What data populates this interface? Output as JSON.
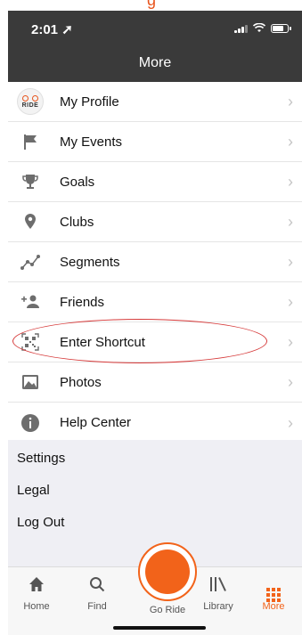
{
  "status": {
    "time": "2:01",
    "location_arrow": "➚"
  },
  "header": {
    "title": "More"
  },
  "menu_items": [
    {
      "label": "My Profile",
      "icon": "avatar"
    },
    {
      "label": "My Events",
      "icon": "flag-icon"
    },
    {
      "label": "Goals",
      "icon": "trophy-icon"
    },
    {
      "label": "Clubs",
      "icon": "map-pin-icon"
    },
    {
      "label": "Segments",
      "icon": "segments-icon"
    },
    {
      "label": "Friends",
      "icon": "add-friend-icon"
    },
    {
      "label": "Enter Shortcut",
      "icon": "qr-code-icon"
    },
    {
      "label": "Photos",
      "icon": "photos-icon"
    },
    {
      "label": "Help Center",
      "icon": "info-icon"
    }
  ],
  "avatar_text": "RIDE",
  "chevron": "›",
  "settings": {
    "settings": "Settings",
    "legal": "Legal",
    "logout": "Log Out"
  },
  "tabs": {
    "home": "Home",
    "find": "Find",
    "goride": "Go Ride",
    "library": "Library",
    "more": "More"
  },
  "colors": {
    "accent": "#f2631a",
    "header_bg": "#3a3a3a",
    "annotation": "#d63a3a"
  }
}
